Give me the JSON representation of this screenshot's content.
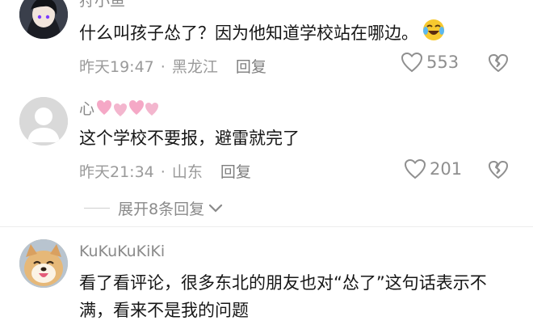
{
  "comments": [
    {
      "username": "狩小鱼",
      "text": "什么叫孩子怂了？因为他知道学校站在哪边。",
      "time": "昨天19:47",
      "location": "黑龙江",
      "reply_label": "回复",
      "likes": "553",
      "emoji_icon": "laugh-cry-emoji"
    },
    {
      "username": "心",
      "username_decoration": "pink-hearts",
      "text": "这个学校不要报，避雷就完了",
      "time": "昨天21:34",
      "location": "山东",
      "reply_label": "回复",
      "likes": "201"
    },
    {
      "username": "KuKuKuKiKi",
      "text": "看了看评论，很多东北的朋友也对“怂了”这句话表示不满，看来不是我的问题"
    }
  ],
  "expand_replies": "展开8条回复",
  "separator": "·",
  "colors": {
    "heart_outline": "#8f8f8f",
    "pink_hearts": "#f5a8c6",
    "emoji_yellow": "#f7c92f"
  }
}
